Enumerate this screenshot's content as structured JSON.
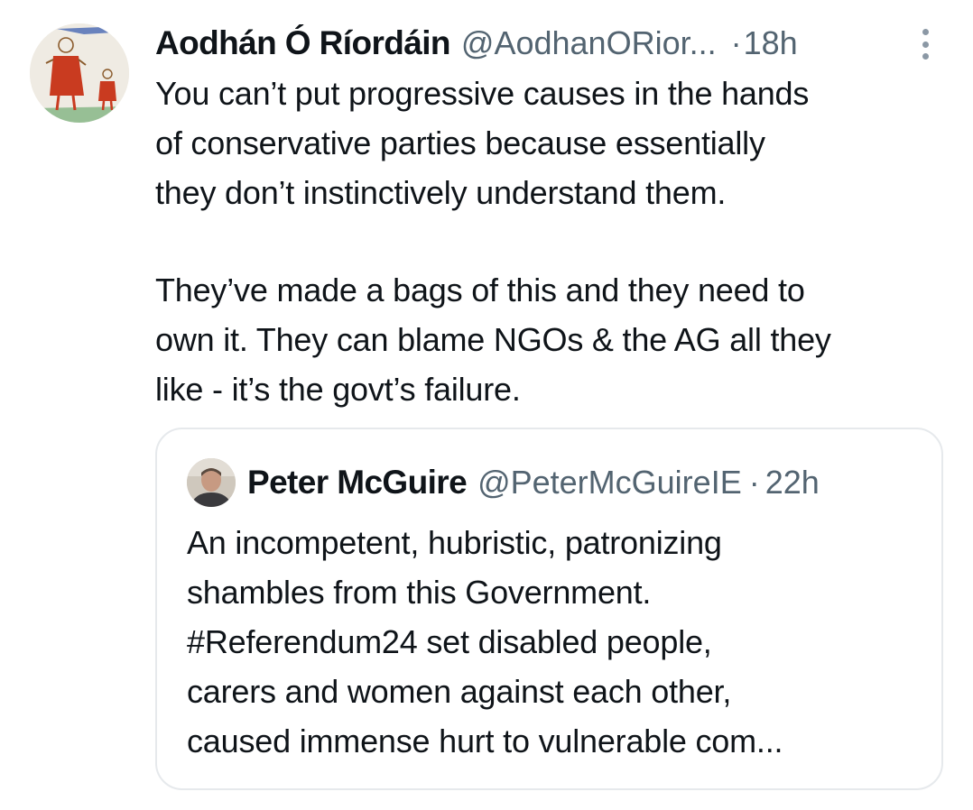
{
  "tweet": {
    "author_name": "Aodhán Ó Ríordáin",
    "author_handle": "@AodhanORior...",
    "separator": "·",
    "time": "18h",
    "avatar_icon": "child-drawing-avatar",
    "more_icon": "more-vertical-icon",
    "body_lines": [
      "You can’t put progressive causes in the hands",
      "of conservative parties because essentially",
      "they don’t instinctively understand them.",
      "They’ve made a bags of this and they need to",
      "own it. They can blame NGOs & the AG all they",
      "like - it’s the govt’s failure."
    ]
  },
  "quoted_tweet": {
    "author_name": "Peter McGuire",
    "author_handle": "@PeterMcGuireIE",
    "separator": "·",
    "time": "22h",
    "avatar_icon": "person-photo-avatar",
    "body_lines": [
      "An incompetent, hubristic, patronizing",
      "shambles from this Government.",
      "#Referendum24 set disabled people,",
      "carers and women against each other,",
      "caused immense hurt to vulnerable com..."
    ]
  },
  "colors": {
    "text_primary": "#0f1419",
    "text_secondary": "#536471",
    "border": "#e6e9ec",
    "background": "#ffffff"
  }
}
